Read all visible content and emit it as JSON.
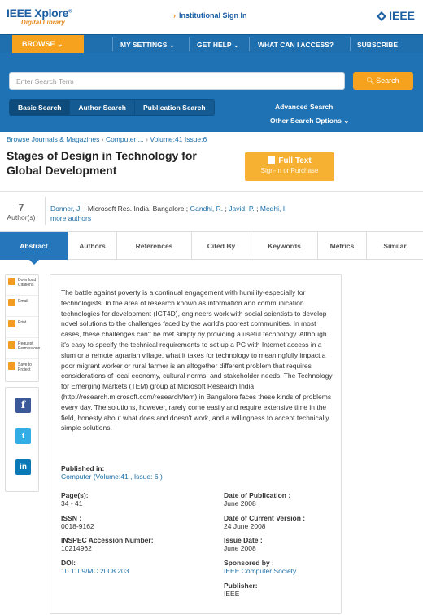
{
  "header": {
    "logo_main": "IEEE Xplore",
    "logo_reg": "®",
    "logo_sub": "Digital Library",
    "institutional_signin": "Institutional Sign In",
    "ieee_brand": "IEEE"
  },
  "nav": {
    "items": [
      "BROWSE ⌄",
      "MY SETTINGS ⌄",
      "GET HELP ⌄",
      "WHAT CAN I ACCESS?",
      "SUBSCRIBE"
    ]
  },
  "search": {
    "placeholder": "Enter Search Term",
    "button_label": "Search",
    "tabs": [
      "Basic Search",
      "Author Search",
      "Publication Search"
    ],
    "advanced": "Advanced Search",
    "other_options": "Other Search Options ⌄"
  },
  "breadcrumb": [
    "Browse Journals & Magazines",
    "Computer ...",
    "Volume:41 Issue:6"
  ],
  "article": {
    "title": "Stages of Design in Technology for Global Development",
    "fulltext_label": "Full Text",
    "fulltext_sub": "Sign-In or Purchase"
  },
  "authors": {
    "count": "7",
    "count_label": "Author(s)",
    "list": [
      {
        "name": "Donner, J.",
        "after": " ; Microsoft Res. India, Bangalore ; "
      },
      {
        "name": "Gandhi, R.",
        "after": " ; "
      },
      {
        "name": "Javid, P.",
        "after": " ; "
      },
      {
        "name": "Medhi, I.",
        "after": ""
      }
    ],
    "more": "more authors"
  },
  "tabs": [
    "Abstract",
    "Authors",
    "References",
    "Cited By",
    "Keywords",
    "Metrics",
    "Similar"
  ],
  "sidebar": {
    "tools": [
      {
        "label": "Download Citations"
      },
      {
        "label": "Email"
      },
      {
        "label": "Print"
      },
      {
        "label": "Request Permissions"
      },
      {
        "label": "Save to Project"
      }
    ],
    "social": [
      "f",
      "t",
      "in"
    ]
  },
  "abstract": {
    "text": "The battle against poverty is a continual engagement with humility-especially for technologists. In the area of research known as information and communication technologies for development (ICT4D), engineers work with social scientists to develop novel solutions to the challenges faced by the world's poorest communities. In most cases, these challenges can't be met simply by providing a useful technology. Although it's easy to specify the technical requirements to set up a PC with Internet access in a slum or a remote agrarian village, what it takes for technology to meaningfully impact a poor migrant worker or rural farmer is an altogether different problem that requires considerations of local economy, cultural norms, and stakeholder needs. The Technology for Emerging Markets (TEM) group at Microsoft Research India (http://research.microsoft.com/research/tem) in Bangalore faces these kinds of problems every day. The solutions, however, rarely come easily and require extensive time in the field, honesty about what does and doesn't work, and a willingness to accept technically simple solutions."
  },
  "pubinfo": {
    "published_in_label": "Published in:",
    "journal": "Computer",
    "volume": "(Volume:41 ,",
    "issue": "Issue: 6 )",
    "pages_label": "Page(s):",
    "pages": "34 - 41",
    "issn_label": "ISSN :",
    "issn": "0018-9162",
    "inspec_label": "INSPEC Accession Number:",
    "inspec": "10214962",
    "doi_label": "DOI:",
    "doi": "10.1109/MC.2008.203",
    "date_pub_label": "Date of Publication :",
    "date_pub": "June 2008",
    "date_ver_label": "Date of Current Version :",
    "date_ver": "24 June 2008",
    "issue_date_label": "Issue Date :",
    "issue_date": "June 2008",
    "sponsor_label": "Sponsored by :",
    "sponsor": "IEEE Computer Society",
    "publisher_label": "Publisher:",
    "publisher": "IEEE"
  },
  "colors": {
    "brand_blue": "#1f72b3",
    "accent_orange": "#f6a21e",
    "link": "#1a6ea8"
  }
}
